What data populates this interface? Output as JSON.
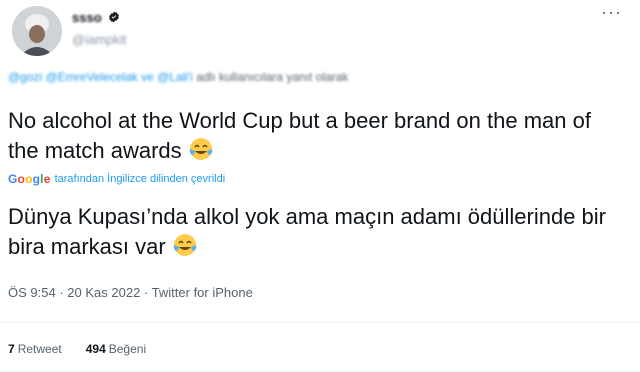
{
  "header": {
    "display_name": "ssso",
    "handle": "@iampkit",
    "more_icon": "more-horizontal-icon",
    "verified_icon": "verified-badge-icon",
    "verified_color": "#1d1d1d"
  },
  "reply": {
    "mentions": "@gozi @EmreVelecelak ve @Lali'i",
    "rest": "adlı kullanıcılara yanıt olarak"
  },
  "tweet": {
    "text": "No alcohol at the World Cup but a beer brand on the man of the match awards",
    "emoji_icon": "face-with-tears-of-joy-icon",
    "translated_text": "Dünya Kupası’nda alkol yok ama maçın adamı ödüllerinde bir bira markası var"
  },
  "translation": {
    "provider": "Google",
    "label": "tarafından İngilizce dilinden çevrildi",
    "provider_colors": [
      "#4285f4",
      "#ea4335",
      "#fbbc05",
      "#4285f4",
      "#34a853",
      "#ea4335"
    ]
  },
  "meta": {
    "time": "ÖS 9:54",
    "date": "20 Kas 2022",
    "source": "Twitter for iPhone",
    "separator": "·"
  },
  "stats": {
    "retweets_count": "7",
    "retweets_label": "Retweet",
    "likes_count": "494",
    "likes_label": "Beğeni"
  },
  "colors": {
    "accent": "#1d9bf0",
    "text": "#0f1419",
    "muted": "#536471",
    "divider": "#eff3f4"
  }
}
